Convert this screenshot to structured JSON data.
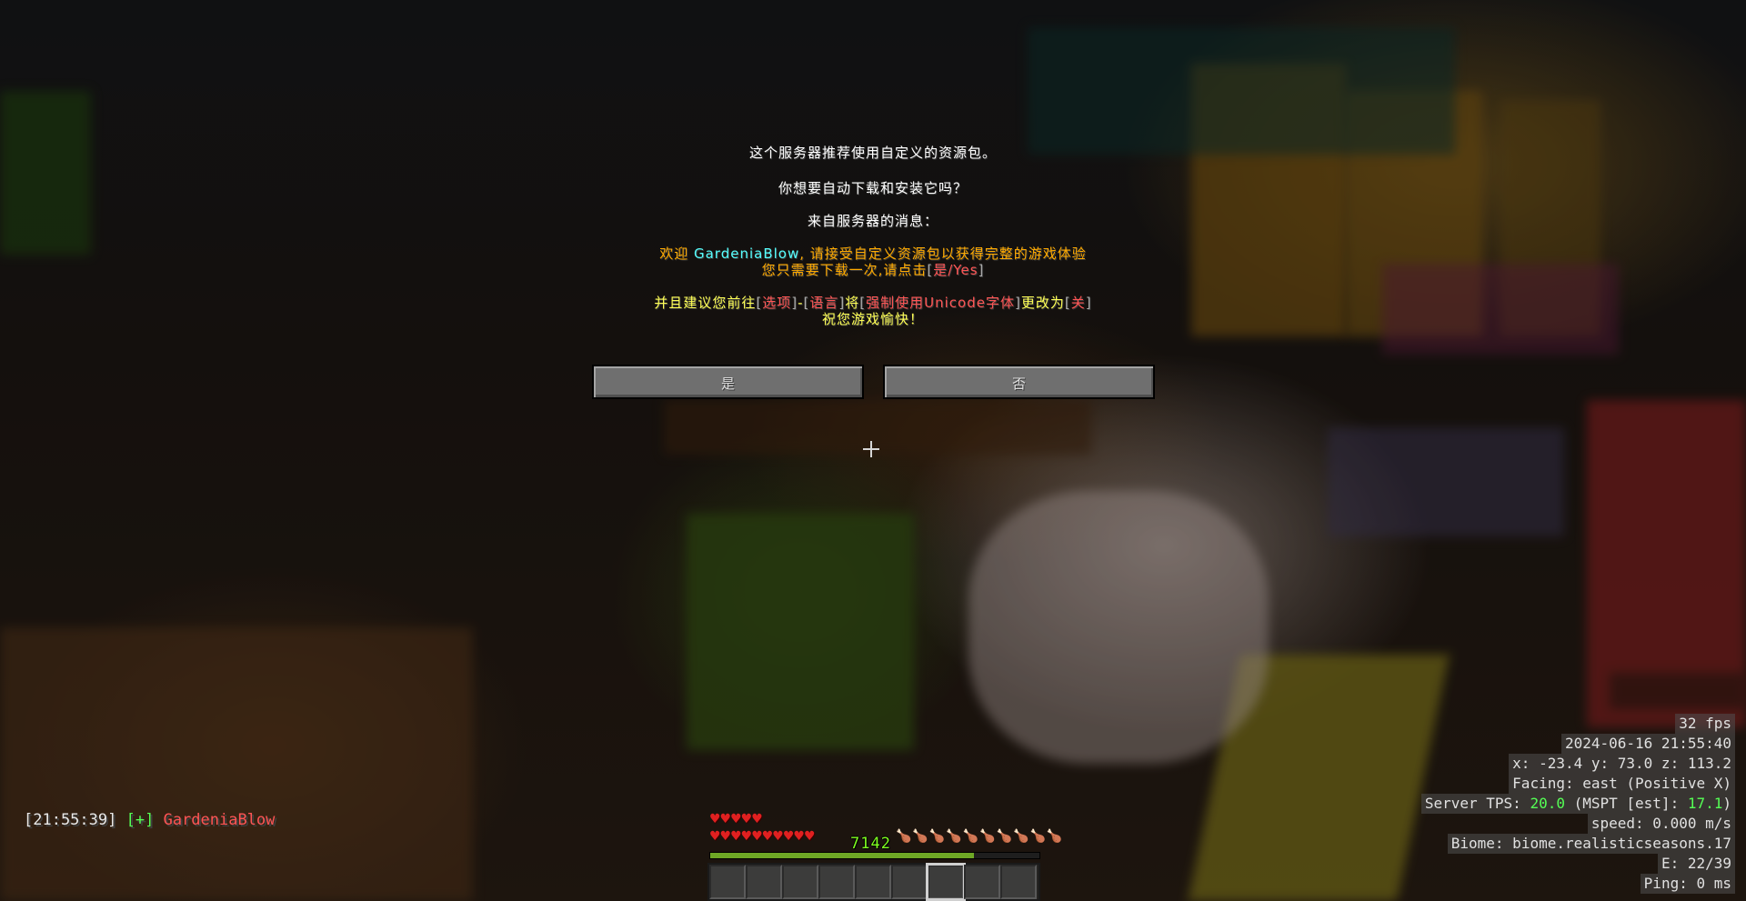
{
  "dialog": {
    "line1": "这个服务器推荐使用自定义的资源包。",
    "line2": "你想要自动下载和安装它吗？",
    "line3": "来自服务器的消息：",
    "msg1": {
      "p1": "欢迎 ",
      "player": "GardeniaBlow",
      "p2": ", 请接受自定义资源包以获得完整的游戏体验"
    },
    "msg2": {
      "p1": "您只需要下载一次,请点击",
      "lb": "[",
      "yes": "是/Yes",
      "rb": "]"
    },
    "msg3": {
      "p1": "并且建议您前往",
      "lb1": "[",
      "opt": "选项",
      "rb1": "]",
      "dash": "-",
      "lb2": "[",
      "lang": "语言",
      "rb2": "]",
      "p2": "将",
      "lb3": "[",
      "force": "强制使用Unicode字体",
      "rb3": "]",
      "p3": "更改为",
      "lb4": "[",
      "off": "关",
      "rb4": "]"
    },
    "msg4": "祝您游戏愉快！",
    "yes_button": "是",
    "no_button": "否"
  },
  "chat": {
    "time": "[21:55:39]",
    "join": "[+]",
    "player": "GardeniaBlow"
  },
  "debug": {
    "fps": "32 fps",
    "datetime": "2024-06-16 21:55:40",
    "coords": "x: -23.4 y: 73.0 z: 113.2",
    "facing": "Facing: east (Positive X)",
    "tps_prefix": "Server TPS: ",
    "tps": "20.0",
    "mspt_prefix": " (MSPT [est]: ",
    "mspt": "17.1",
    "mspt_suffix": ")",
    "speed": "speed: 0.000 m/s",
    "biome": "Biome: biome.realisticseasons.17",
    "entities": "E: 22/39",
    "ping": "Ping: 0 ms"
  },
  "hud": {
    "hearts_row1": "♥♥♥♥♥",
    "hearts_row2": "♥♥♥♥♥♥♥♥♥♥",
    "hunger": "🍗🍗🍗🍗🍗🍗🍗🍗🍗🍗",
    "level": "7142",
    "xp_progress": 0.8,
    "hotbar_slots": 9,
    "selected_slot": 7
  },
  "colors": {
    "gold": "#ffaa00",
    "aqua": "#55ffff",
    "red": "#ff5555",
    "yellow": "#ffff55",
    "green": "#55ff55"
  }
}
